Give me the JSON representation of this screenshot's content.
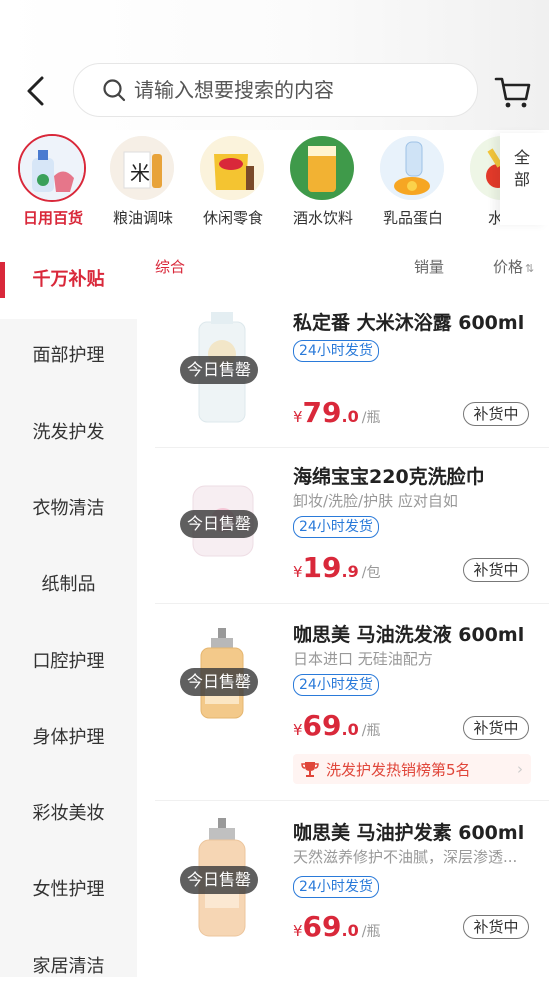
{
  "header": {
    "search_placeholder": "请输入想要搜索的内容",
    "back_icon": "back-arrow-icon",
    "cart_icon": "cart-icon"
  },
  "categories": [
    {
      "label": "日用百货",
      "active": true
    },
    {
      "label": "粮油调味",
      "active": false
    },
    {
      "label": "休闲零食",
      "active": false
    },
    {
      "label": "酒水饮料",
      "active": false
    },
    {
      "label": "乳品蛋白",
      "active": false
    },
    {
      "label": "水果",
      "active": false
    }
  ],
  "all_categories_label": "全部",
  "sidebar": {
    "items": [
      {
        "label": "千万补贴",
        "active": true
      },
      {
        "label": "面部护理"
      },
      {
        "label": "洗发护发"
      },
      {
        "label": "衣物清洁"
      },
      {
        "label": "纸制品"
      },
      {
        "label": "口腔护理"
      },
      {
        "label": "身体护理"
      },
      {
        "label": "彩妆美妆"
      },
      {
        "label": "女性护理"
      },
      {
        "label": "家居清洁"
      }
    ]
  },
  "sort": {
    "default_label": "综合",
    "sales_label": "销量",
    "price_label": "价格"
  },
  "products": [
    {
      "title": "私定番 大米沐浴露 600ml",
      "subtitle": "",
      "sold_out": "今日售罄",
      "tag": "24小时发货",
      "currency": "¥",
      "price_int": "79",
      "price_dec": ".0",
      "unit": "/瓶",
      "restock": "补货中"
    },
    {
      "title": "海绵宝宝220克洗脸巾",
      "subtitle": "卸妆/洗脸/护肤 应对自如",
      "sold_out": "今日售罄",
      "tag": "24小时发货",
      "currency": "¥",
      "price_int": "19",
      "price_dec": ".9",
      "unit": "/包",
      "restock": "补货中"
    },
    {
      "title": "咖思美 马油洗发液 600ml",
      "subtitle": "日本进口 无硅油配方",
      "sold_out": "今日售罄",
      "tag": "24小时发货",
      "currency": "¥",
      "price_int": "69",
      "price_dec": ".0",
      "unit": "/瓶",
      "restock": "补货中",
      "rank": "洗发护发热销榜第5名"
    },
    {
      "title": "咖思美 马油护发素 600ml",
      "subtitle": "天然滋养修护不油腻，深层渗透...",
      "sold_out": "今日售罄",
      "tag": "24小时发货",
      "currency": "¥",
      "price_int": "69",
      "price_dec": ".0",
      "unit": "/瓶",
      "restock": "补货中"
    }
  ],
  "colors": {
    "accent": "#d9283a",
    "tag_blue": "#2a7ad9"
  }
}
